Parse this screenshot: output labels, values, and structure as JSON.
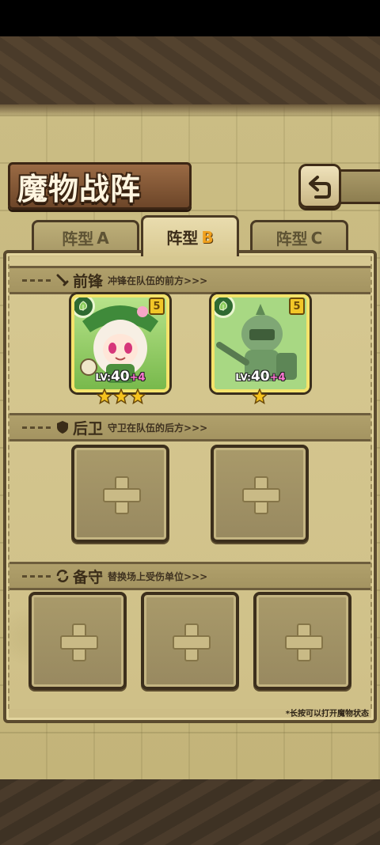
{
  "header": {
    "title": "魔物战阵"
  },
  "tabs": [
    {
      "label": "阵型",
      "letter": "A",
      "active": false
    },
    {
      "label": "阵型",
      "letter": "B",
      "active": true
    },
    {
      "label": "阵型",
      "letter": "C",
      "active": false
    }
  ],
  "sections": {
    "front": {
      "name": "前锋",
      "desc": "冲锋在队伍的前方>>>"
    },
    "rear": {
      "name": "后卫",
      "desc": "守卫在队伍的后方>>>"
    },
    "reserve": {
      "name": "备守",
      "desc": "替换场上受伤单位>>>"
    }
  },
  "front_monsters": [
    {
      "name": "white-hair-girl-monster",
      "level_prefix": "LV:",
      "level": "40",
      "bonus": "+4",
      "stars": 3,
      "rank": "5",
      "element": "leaf-icon"
    },
    {
      "name": "green-knight-monster",
      "level_prefix": "LV:",
      "level": "40",
      "bonus": "+4",
      "stars": 1,
      "rank": "5",
      "element": "leaf-icon"
    }
  ],
  "hint": "*长按可以打开魔物状态",
  "colors": {
    "accent": "#f0a01d",
    "bonus": "#ff78d4",
    "leaf": "#2f6a31"
  }
}
